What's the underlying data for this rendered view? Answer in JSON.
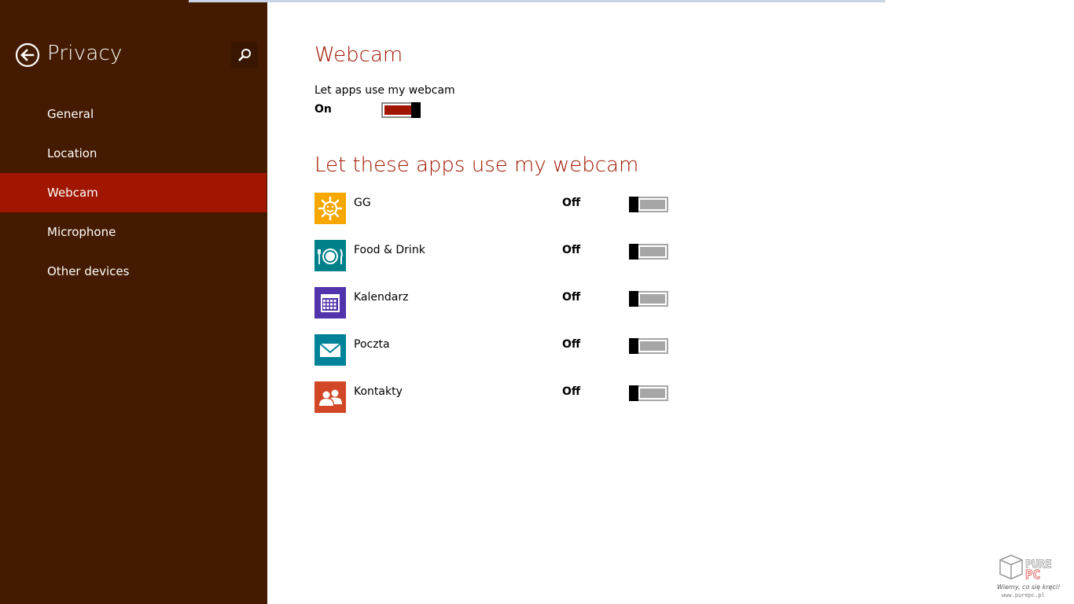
{
  "sidebar": {
    "title": "Privacy",
    "items": [
      {
        "label": "General",
        "selected": false
      },
      {
        "label": "Location",
        "selected": false
      },
      {
        "label": "Webcam",
        "selected": true
      },
      {
        "label": "Microphone",
        "selected": false
      },
      {
        "label": "Other devices",
        "selected": false
      }
    ],
    "colors": {
      "background": "#441b00",
      "selected": "#a01600"
    }
  },
  "main": {
    "heading": "Webcam",
    "master_setting": {
      "label": "Let apps use my webcam",
      "state": "On",
      "enabled": true
    },
    "apps_heading": "Let these apps use my webcam",
    "apps": [
      {
        "name": "GG",
        "state": "Off",
        "icon": "sun-smile-icon",
        "tile_color": "#f7a700"
      },
      {
        "name": "Food & Drink",
        "state": "Off",
        "icon": "plate-cutlery-icon",
        "tile_color": "#00818a"
      },
      {
        "name": "Kalendarz",
        "state": "Off",
        "icon": "calendar-icon",
        "tile_color": "#5133ab"
      },
      {
        "name": "Poczta",
        "state": "Off",
        "icon": "mail-envelope-icon",
        "tile_color": "#008299"
      },
      {
        "name": "Kontakty",
        "state": "Off",
        "icon": "people-icon",
        "tile_color": "#d24726"
      }
    ],
    "accent_color": "#a01600"
  },
  "watermark": {
    "text": "PurePC",
    "tagline": "Wiemy, co się kręci!",
    "url": "www.purepc.pl"
  }
}
